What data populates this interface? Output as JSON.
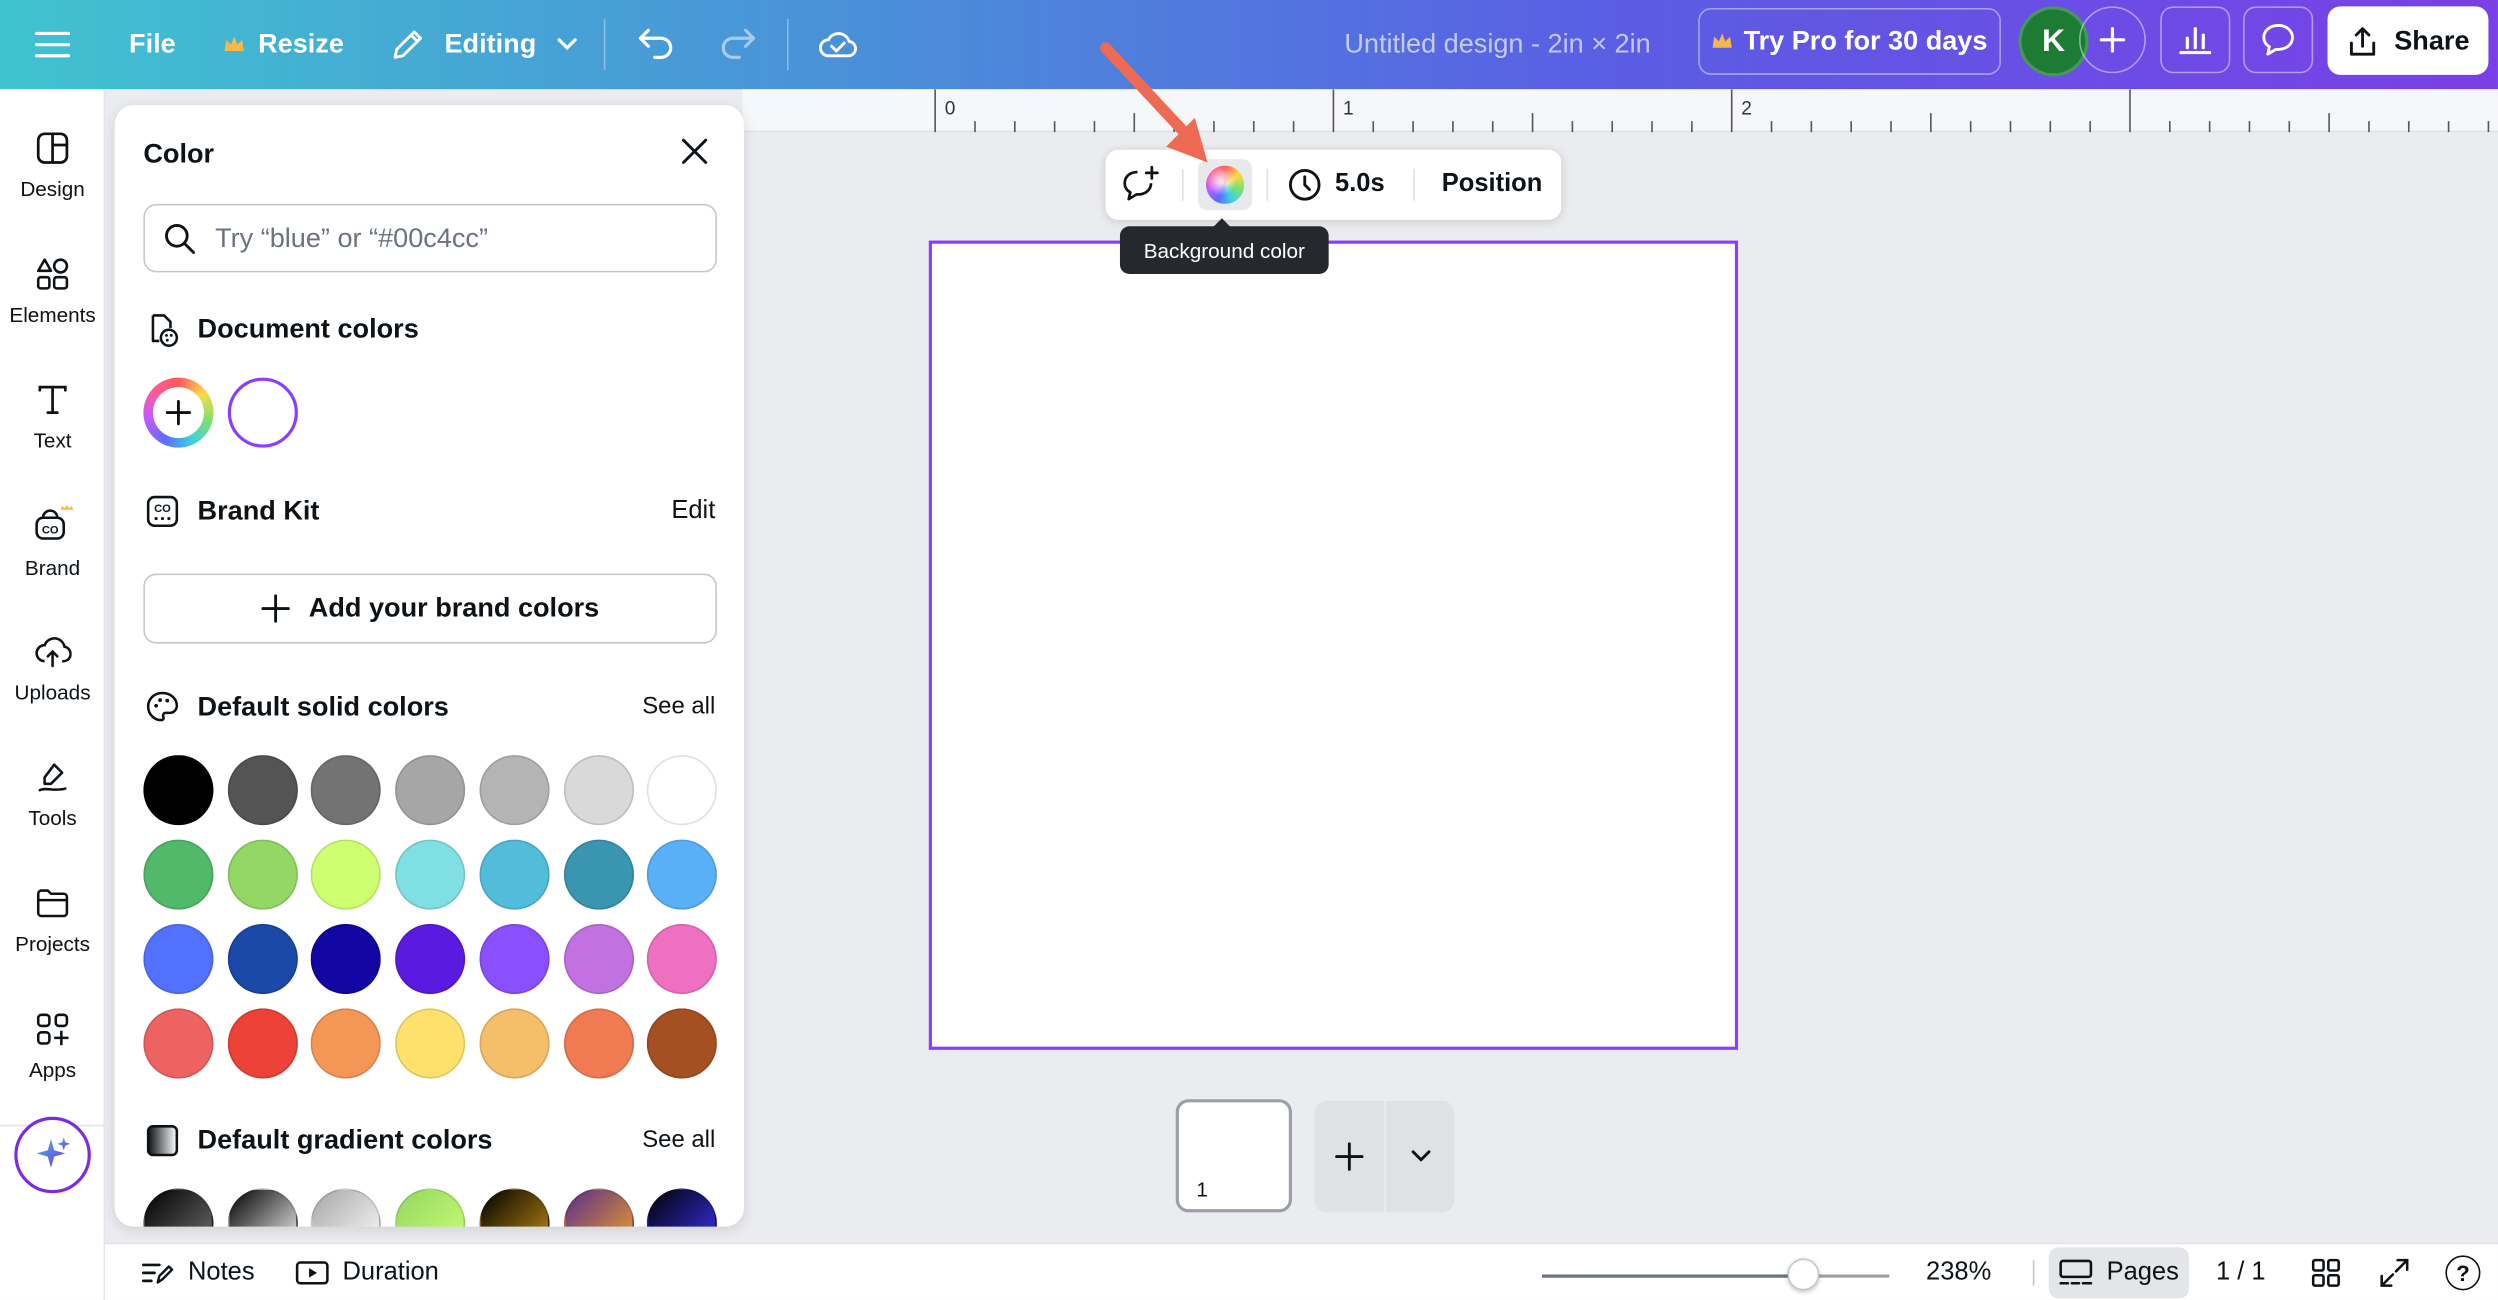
{
  "topbar": {
    "file_label": "File",
    "resize_label": "Resize",
    "editing_label": "Editing",
    "title": "Untitled design - 2in × 2in",
    "pro_label": "Try Pro for 30 days",
    "avatar_letter": "K",
    "share_label": "Share"
  },
  "sidebar": {
    "items": [
      {
        "label": "Design",
        "icon": "design-icon"
      },
      {
        "label": "Elements",
        "icon": "elements-icon"
      },
      {
        "label": "Text",
        "icon": "text-icon"
      },
      {
        "label": "Brand",
        "icon": "brand-icon"
      },
      {
        "label": "Uploads",
        "icon": "uploads-icon"
      },
      {
        "label": "Tools",
        "icon": "tools-icon"
      },
      {
        "label": "Projects",
        "icon": "projects-icon"
      },
      {
        "label": "Apps",
        "icon": "apps-icon"
      }
    ]
  },
  "color_panel": {
    "title": "Color",
    "search_placeholder": "Try “blue” or “#00c4cc”",
    "document_colors_label": "Document colors",
    "document_colors": [
      "#ffffff"
    ],
    "brand_kit_label": "Brand Kit",
    "brand_kit_edit": "Edit",
    "add_brand_label": "Add your brand colors",
    "solid_label": "Default solid colors",
    "solid_see_all": "See all",
    "solid_colors": [
      [
        "#000000",
        "#545454",
        "#737373",
        "#a6a6a6",
        "#b4b4b4",
        "#d9d9d9",
        "#ffffff"
      ],
      [
        "#50b96a",
        "#93d764",
        "#cdff71",
        "#80dfe2",
        "#52bcdb",
        "#3a95b1",
        "#5ab0f7"
      ],
      [
        "#5271ff",
        "#1b49a9",
        "#1105a3",
        "#5b1ae0",
        "#8a4ffe",
        "#c271e0",
        "#ef70c0"
      ],
      [
        "#ef6262",
        "#ec4237",
        "#f49655",
        "#fde16c",
        "#f5be68",
        "#f07b52",
        "#a55022"
      ]
    ],
    "gradient_label": "Default gradient colors",
    "gradient_see_all": "See all",
    "gradients": [
      [
        "#000000",
        "#737373"
      ],
      [
        "#000000",
        "#ffffff"
      ],
      [
        "#a6a6a6",
        "#ffffff"
      ],
      [
        "#93d764",
        "#cdff71"
      ],
      [
        "#000000",
        "#c89116"
      ],
      [
        "#5b2d8a",
        "#f5a623"
      ],
      [
        "#000000",
        "#3b36ff"
      ]
    ]
  },
  "ruler": {
    "labels": [
      "0",
      "1",
      "2"
    ]
  },
  "context_toolbar": {
    "duration": "5.0s",
    "position_label": "Position",
    "tooltip": "Background color"
  },
  "page_thumb": {
    "number": "1"
  },
  "bottombar": {
    "notes_label": "Notes",
    "duration_label": "Duration",
    "zoom_value": 0.75,
    "zoom_label": "238%",
    "pages_label": "Pages",
    "page_count": "1 / 1",
    "help_label": "?"
  },
  "colors": {
    "accent": "#8b3dff",
    "annotation_arrow": "#ee6a52"
  }
}
